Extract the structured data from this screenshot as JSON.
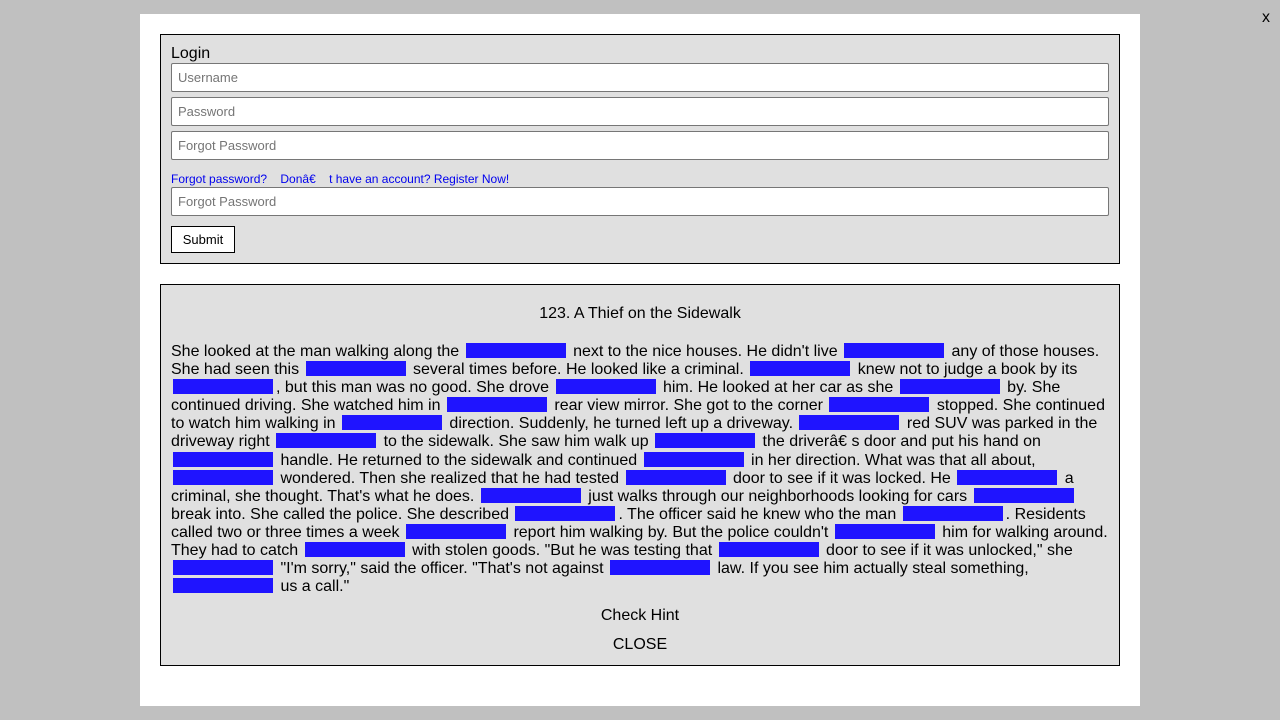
{
  "overlay": {
    "close_label": "x"
  },
  "login": {
    "title": "Login",
    "username_placeholder": "Username",
    "password_placeholder": "Password",
    "forgot_placeholder_1": "Forgot Password",
    "forgot_link": "Forgot password?",
    "register_link": "Donâ€    t have an account? Register Now!",
    "forgot_placeholder_2": "Forgot Password",
    "submit_label": "Submit"
  },
  "story": {
    "title": "123. A Thief on the Sidewalk",
    "segments": [
      "She looked at the man walking along the ",
      " next to the nice houses. He didn't live ",
      " any of those houses. She had seen this ",
      " several times before. He looked like a criminal. ",
      " knew not to judge a book by its ",
      ", but this man was no good. She drove ",
      " him. He looked at her car as she ",
      " by. She continued driving. She watched him in ",
      " rear view mirror. She got to the corner ",
      " stopped. She continued to watch him walking in ",
      " direction. Suddenly, he turned left up a driveway. ",
      " red SUV was parked in the driveway right ",
      " to the sidewalk. She saw him walk up ",
      " the driverâ€    s door and put his hand on ",
      " handle. He returned to the sidewalk and continued ",
      " in her direction. What was that all about, ",
      " wondered. Then she realized that he had tested ",
      " door to see if it was locked. He ",
      " a criminal, she thought. That's what he does. ",
      " just walks through our neighborhoods looking for cars ",
      " break into. She called the police. She described ",
      ". The officer said he knew who the man ",
      ". Residents called two or three times a week ",
      " report him walking by. But the police couldn't ",
      " him for walking around. They had to catch ",
      " with stolen goods. \"But he was testing that ",
      " door to see if it was unlocked,\" she ",
      " \"I'm sorry,\" said the officer. \"That's not against ",
      " law. If you see him actually steal something, ",
      " us a call.\""
    ],
    "check_hint_label": "Check Hint",
    "close_label": "CLOSE"
  },
  "colors": {
    "blank_fill": "#1f14ff",
    "link": "#0000ee",
    "panel": "#e0e0e0",
    "backdrop": "#c0c0c0"
  }
}
